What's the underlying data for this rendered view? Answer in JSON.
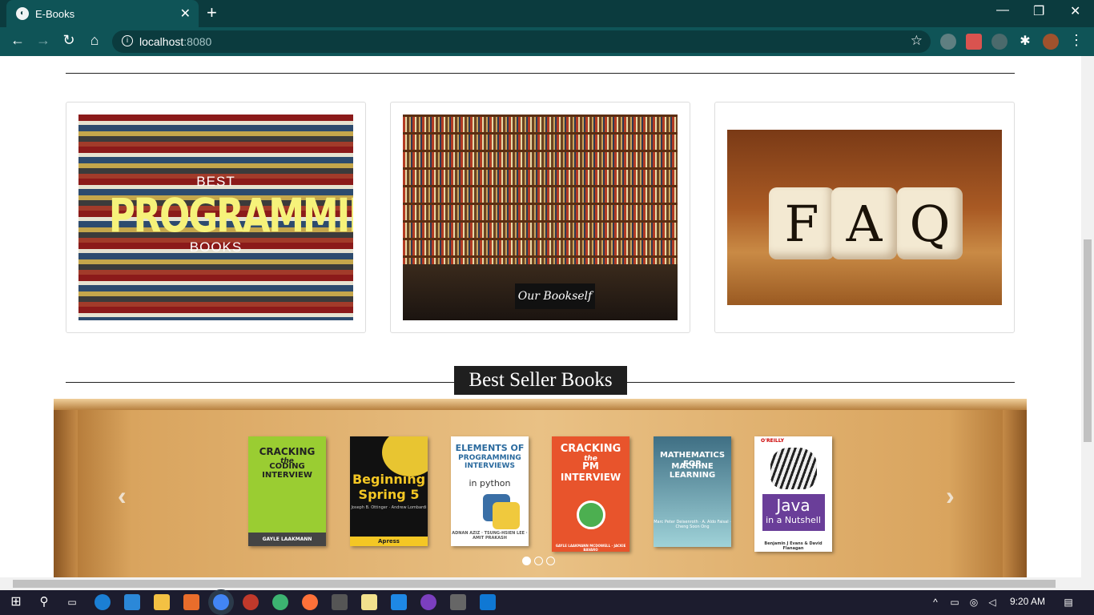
{
  "browser": {
    "tab_title": "E-Books",
    "tab_close": "✕",
    "new_tab": "+",
    "url_host": "localhost",
    "url_port": ":8080",
    "window_controls": {
      "minimize": "—",
      "restore": "❐",
      "close": "✕"
    }
  },
  "nav": {
    "back": "←",
    "forward": "→",
    "reload": "↻",
    "home": "⌂",
    "star": "☆",
    "menu": "⋮"
  },
  "cards": [
    {
      "overlay_top": "BEST",
      "overlay_main": "PROGRAMMING",
      "overlay_bottom": "BOOKS"
    },
    {
      "overlay_label": "Our Bookself"
    },
    {
      "dice": [
        "F",
        "A",
        "Q"
      ]
    }
  ],
  "bestseller": {
    "title": "Best Seller Books",
    "prev": "‹",
    "next": "›",
    "books": [
      {
        "line1": "CRACKING",
        "line2": "the",
        "line3": "CODING INTERVIEW",
        "author": "GAYLE LAAKMANN MCDOWELL",
        "bg": "#9acd32"
      },
      {
        "line1": "Beginning",
        "line2": "Spring 5",
        "line3": "Joseph B. Ottinger · Andrew Lombardi",
        "author": "Apress",
        "bg": "#111111"
      },
      {
        "line1": "ELEMENTS OF",
        "line2": "PROGRAMMING INTERVIEWS",
        "line3": "in python",
        "author": "ADNAN AZIZ · TSUNG-HSIEN LEE · AMIT PRAKASH",
        "bg": "#ffffff"
      },
      {
        "line1": "CRACKING",
        "line2": "the",
        "line3": "PM INTERVIEW",
        "author": "GAYLE LAAKMANN MCDOWELL · JACKIE BAVARO",
        "bg": "#e8542c"
      },
      {
        "line1": "MATHEMATICS FOR",
        "line2": "MACHINE LEARNING",
        "line3": "",
        "author": "Marc Peter Deisenroth · A. Aldo Faisal · Cheng Soon Ong",
        "bg": "#3f6f84"
      },
      {
        "line1": "O'REILLY",
        "line2": "Java",
        "line3": "in a Nutshell",
        "author": "Benjamin J Evans & David Flanagan",
        "bg": "#ffffff"
      }
    ],
    "carousel_pages": 3,
    "active_page": 1
  },
  "taskbar": {
    "time": "9:20 AM"
  }
}
